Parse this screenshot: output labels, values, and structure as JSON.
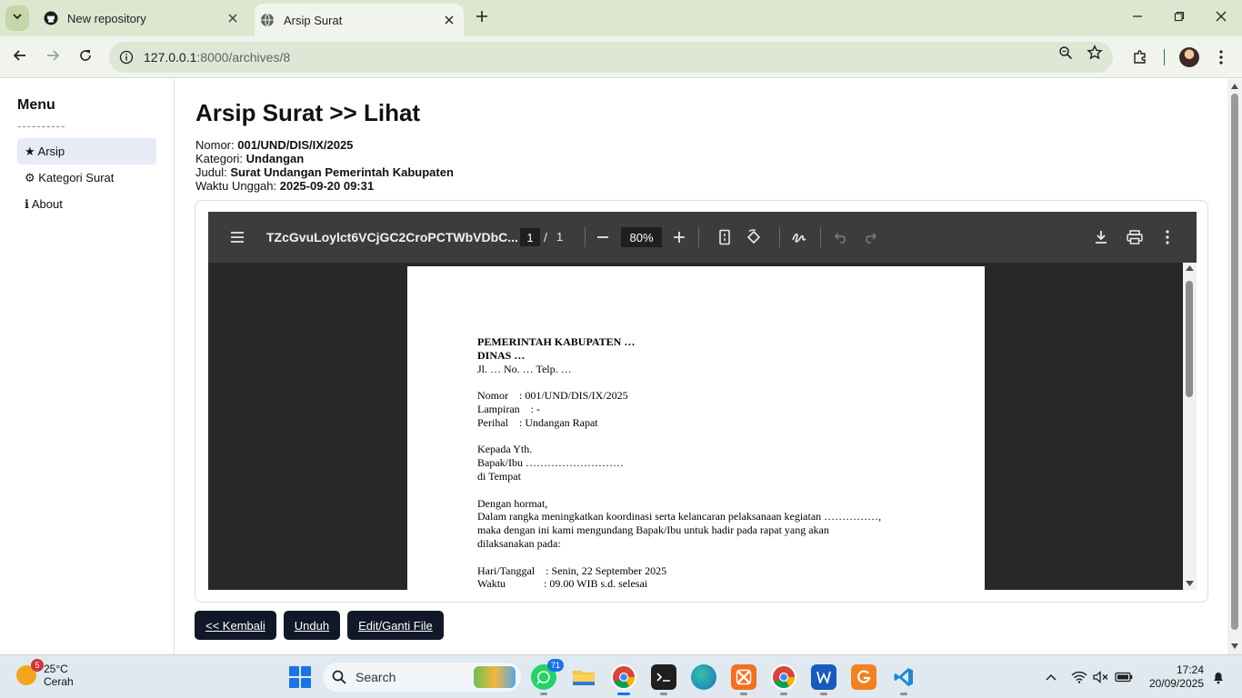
{
  "browser": {
    "tabs": [
      {
        "title": "New repository",
        "icon": "github-icon",
        "active": false
      },
      {
        "title": "Arsip Surat",
        "icon": "globe-icon",
        "active": true
      }
    ],
    "url_host": "127.0.0.1",
    "url_path": ":8000/archives/8"
  },
  "sidebar": {
    "heading": "Menu",
    "separator": "----------",
    "items": [
      {
        "label": "★ Arsip",
        "active": true
      },
      {
        "label": "⚙ Kategori Surat",
        "active": false
      },
      {
        "label": "ℹ About",
        "active": false
      }
    ]
  },
  "main": {
    "title": "Arsip Surat >> Lihat",
    "meta": [
      {
        "label": "Nomor: ",
        "value": "001/UND/DIS/IX/2025"
      },
      {
        "label": "Kategori: ",
        "value": "Undangan"
      },
      {
        "label": "Judul: ",
        "value": "Surat Undangan Pemerintah Kabupaten"
      },
      {
        "label": "Waktu Unggah: ",
        "value": "2025-09-20 09:31"
      }
    ],
    "buttons": {
      "back": "<< Kembali",
      "download": "Unduh",
      "edit": "Edit/Ganti File"
    }
  },
  "pdf_viewer": {
    "filename": "TZcGvuLoylct6VCjGC2CroPCTWbVDbC...",
    "current_page": "1",
    "page_sep": "/",
    "total_pages": "1",
    "zoom": "80%",
    "letter_lines": [
      {
        "text": "PEMERINTAH KABUPATEN …",
        "bold": true
      },
      {
        "text": "DINAS …",
        "bold": true
      },
      {
        "text": "Jl. … No. … Telp. …",
        "bold": false
      },
      {
        "text": "",
        "bold": false
      },
      {
        "text": "Nomor    : 001/UND/DIS/IX/2025",
        "bold": false
      },
      {
        "text": "Lampiran    : -",
        "bold": false
      },
      {
        "text": "Perihal    : Undangan Rapat",
        "bold": false
      },
      {
        "text": "",
        "bold": false
      },
      {
        "text": "Kepada Yth.",
        "bold": false
      },
      {
        "text": "Bapak/Ibu ………………………",
        "bold": false
      },
      {
        "text": "di Tempat",
        "bold": false
      },
      {
        "text": "",
        "bold": false
      },
      {
        "text": "Dengan hormat,",
        "bold": false
      },
      {
        "text": "Dalam rangka meningkatkan koordinasi serta kelancaran pelaksanaan kegiatan ……………,",
        "bold": false
      },
      {
        "text": "maka dengan ini kami mengundang Bapak/Ibu untuk hadir pada rapat yang akan",
        "bold": false
      },
      {
        "text": "dilaksanakan pada:",
        "bold": false
      },
      {
        "text": "",
        "bold": false
      },
      {
        "text": "Hari/Tanggal    : Senin, 22 September 2025",
        "bold": false
      },
      {
        "text": "Waktu              : 09.00 WIB s.d. selesai",
        "bold": false
      }
    ]
  },
  "taskbar": {
    "weather_temp": "25°C",
    "weather_desc": "Cerah",
    "weather_badge": "5",
    "search_placeholder": "Search",
    "whatsapp_badge": "71",
    "time": "17:24",
    "date": "20/09/2025"
  }
}
